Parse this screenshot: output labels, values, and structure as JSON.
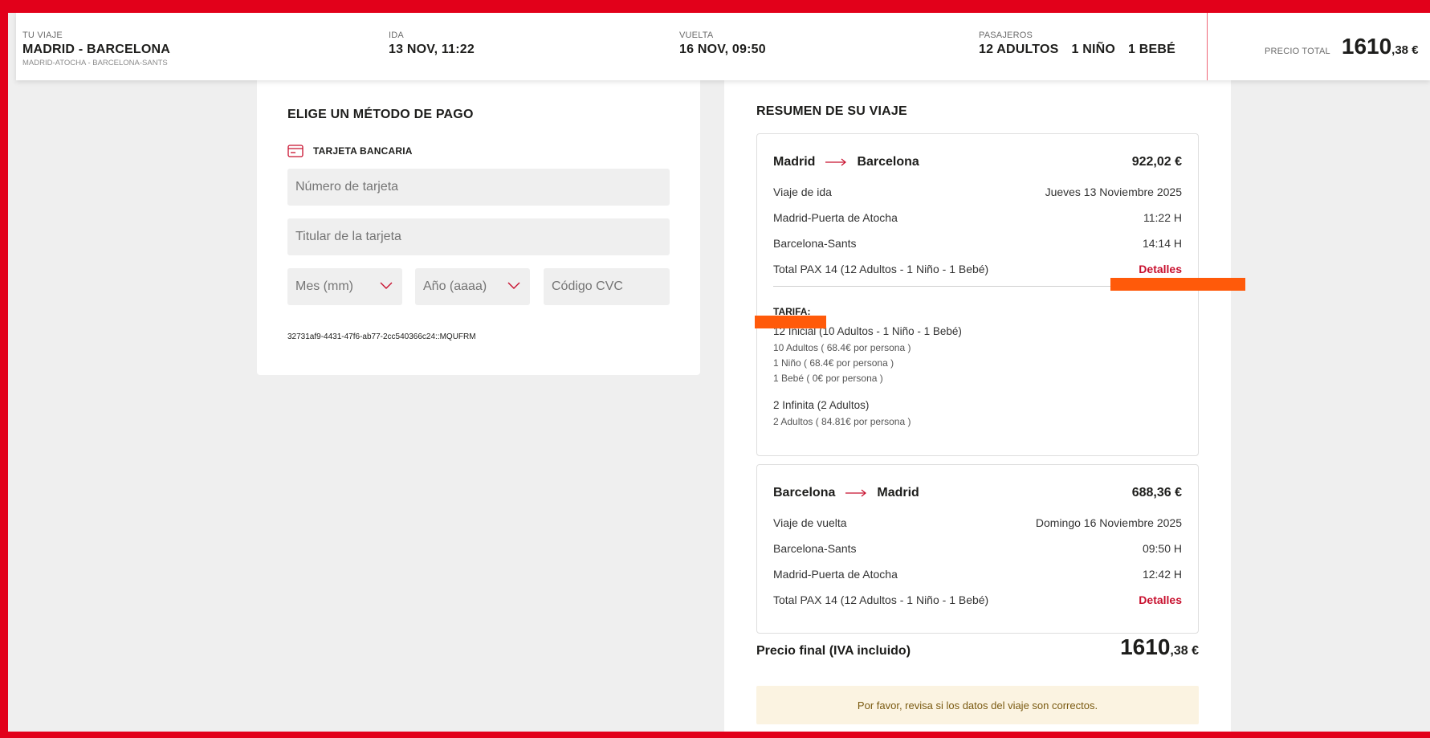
{
  "header": {
    "trip_label": "TU VIAJE",
    "trip_value": "MADRID - BARCELONA",
    "trip_sub": "MADRID-ATOCHA - BARCELONA-SANTS",
    "ida_label": "IDA",
    "ida_value": "13 NOV, 11:22",
    "vuelta_label": "VUELTA",
    "vuelta_value": "16 NOV, 09:50",
    "pasajeros_label": "PASAJEROS",
    "pax_adultos": "12 ADULTOS",
    "pax_nino": "1 NIÑO",
    "pax_bebe": "1 BEBÉ",
    "precio_label": "PRECIO TOTAL",
    "precio_int": "1610",
    "precio_dec": ",38 €"
  },
  "payment": {
    "title": "ELIGE UN MÉTODO DE PAGO",
    "method_label": "TARJETA BANCARIA",
    "card_number_placeholder": "Número de tarjeta",
    "card_holder_placeholder": "Titular de la tarjeta",
    "month_placeholder": "Mes (mm)",
    "year_placeholder": "Año (aaaa)",
    "cvc_placeholder": "Código CVC",
    "token": "32731af9-4431-47f6-ab77-2cc540366c24::MQUFRM"
  },
  "summary": {
    "title": "RESUMEN DE SU VIAJE",
    "outbound": {
      "from": "Madrid",
      "to": "Barcelona",
      "price": "922,02 €",
      "type_label": "Viaje de ida",
      "date": "Jueves 13 Noviembre 2025",
      "origin": "Madrid-Puerta de Atocha",
      "origin_time": "11:22 H",
      "destination": "Barcelona-Sants",
      "destination_time": "14:14 H",
      "pax_total": "Total PAX 14 (12 Adultos - 1 Niño - 1 Bebé)",
      "details_link": "Detalles",
      "tarifa_heading": "TARIFA:",
      "fare1": "12 Inicial (10 Adultos - 1 Niño - 1 Bebé)",
      "fare1_adults": "10 Adultos ( 68.4€ por persona )",
      "fare1_child": "1 Niño ( 68.4€ por persona )",
      "fare1_baby": "1 Bebé ( 0€ por persona )",
      "fare2": "2 Infinita (2 Adultos)",
      "fare2_adults": "2 Adultos ( 84.81€ por persona )"
    },
    "return": {
      "from": "Barcelona",
      "to": "Madrid",
      "price": "688,36 €",
      "type_label": "Viaje de vuelta",
      "date": "Domingo 16 Noviembre 2025",
      "origin": "Barcelona-Sants",
      "origin_time": "09:50 H",
      "destination": "Madrid-Puerta de Atocha",
      "destination_time": "12:42 H",
      "pax_total": "Total PAX 14 (12 Adultos - 1 Niño - 1 Bebé)",
      "details_link": "Detalles"
    },
    "final_label": "Precio final (IVA incluido)",
    "final_int": "1610",
    "final_dec": ",38 €",
    "notice": "Por favor, revisa si los datos del viaje son correctos."
  },
  "colors": {
    "brand_red": "#e2001a",
    "link_red": "#c8102e",
    "annotation_orange": "#ff5a0a",
    "notice_bg": "#fbf3e1"
  }
}
